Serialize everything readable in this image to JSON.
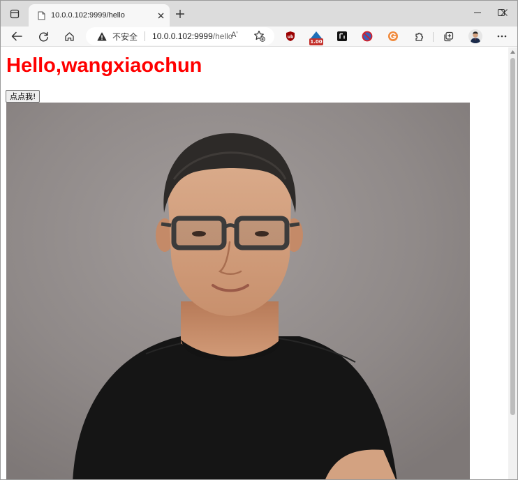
{
  "tab": {
    "title": "10.0.0.102:9999/hello"
  },
  "address_bar": {
    "security_label": "不安全",
    "url_host": "10.0.0.102:9999",
    "url_path": "/hello",
    "read_aloud_glyph": "Aʹ"
  },
  "extensions": {
    "badge_text": "1.00"
  },
  "page": {
    "heading": "Hello,wangxiaochun",
    "button_label": "点点我!"
  },
  "colors": {
    "heading": "#ff0000",
    "tab_strip": "#dcdcdc",
    "toolbar": "#f7f7f7",
    "photo_background": "#8d8786"
  }
}
